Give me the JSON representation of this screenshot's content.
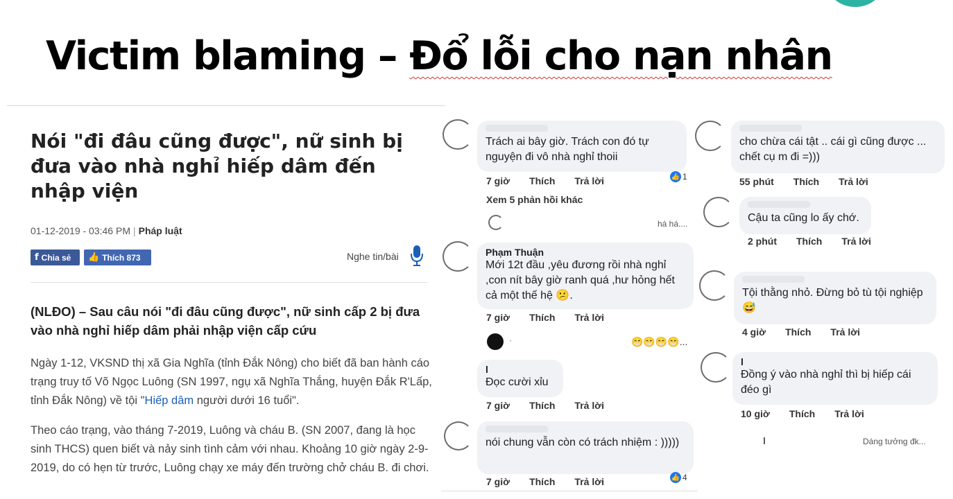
{
  "slide": {
    "title_part1": "Victim blaming – ",
    "title_part2": "Đổ lỗi cho nạn nhân"
  },
  "article": {
    "headline": "Nói \"đi đâu cũng được\", nữ sinh bị đưa vào nhà nghỉ hiếp dâm đến nhập viện",
    "date": "01-12-2019 - 03:46 PM",
    "separator": "|",
    "category": "Pháp luật",
    "share_label": "Chia sẻ",
    "like_label": "Thích 873",
    "listen_label": "Nghe tin/bài",
    "lead": "(NLĐO) – Sau câu nói \"đi đâu cũng được\", nữ sinh cấp 2 bị đưa vào nhà nghỉ hiếp dâm phải nhập viện cấp cứu",
    "para1_before": "Ngày 1-12, VKSND thị xã Gia Nghĩa (tỉnh Đắk Nông) cho biết đã ban hành cáo trạng truy tố Võ Ngọc Luông (SN 1997, ngụ xã Nghĩa Thắng, huyện Đắk R'Lấp, tỉnh Đắk Nông) về tội \"",
    "para1_link": "Hiếp dâm",
    "para1_after": " người dưới 16 tuổi\".",
    "para2": "Theo cáo trạng, vào tháng 7-2019, Luông và cháu B. (SN 2007, đang là học sinh THCS) quen biết và nảy sinh tình cảm với nhau. Khoảng 10 giờ ngày 2-9-2019, do có hẹn từ trước, Luông chạy xe máy đến trường chở cháu B. đi chơi."
  },
  "comments_left": [
    {
      "name": "",
      "text": "Trách ai bây giờ. Trách con đó tự nguyện đi vô nhà nghỉ thoii",
      "time": "7 giờ",
      "like": "Thích",
      "reply": "Trả lời",
      "reactions": "1"
    },
    {
      "more_replies": "Xem 5 phản hồi khác",
      "snippet": "há há...."
    },
    {
      "name": "Phạm Thuận",
      "text": "Mới 12t đầu ,yêu đương rồi nhà nghỉ ,con nít bây giờ ranh quá ,hư hỏng hết cả một thế hệ 😕.",
      "time": "7 giờ",
      "like": "Thích",
      "reply": "Trả lời"
    },
    {
      "dot_label": "·",
      "emoji": "😁😁😁😁..."
    },
    {
      "name": "l",
      "text": "Đọc cười xỉu",
      "time": "7 giờ",
      "like": "Thích",
      "reply": "Trả lời"
    },
    {
      "name": "",
      "text": "nói chung vẫn còn có trách nhiệm : )))))",
      "time": "7 giờ",
      "like": "Thích",
      "reply": "Trả lời",
      "reactions": "4"
    }
  ],
  "comments_right": [
    {
      "name": "",
      "text": "cho chừa cái tật .. cái gì cũng được ... chết cụ m đi =)))",
      "time": "55 phút",
      "like": "Thích",
      "reply": "Trả lời"
    },
    {
      "name": "",
      "text": "Cậu ta cũng lo ấy chớ.",
      "time": "2 phút",
      "like": "Thích",
      "reply": "Trả lời"
    },
    {
      "name": "",
      "text": "Tội thằng nhỏ. Đừng bỏ tù tội nghiệp 😅",
      "time": "4 giờ",
      "like": "Thích",
      "reply": "Trả lời"
    },
    {
      "name": "l",
      "text": "Đồng ý vào nhà nghỉ thì bị hiếp cái đéo gì",
      "time": "10 giờ",
      "like": "Thích",
      "reply": "Trả lời"
    },
    {
      "marker": "l",
      "snippet": "Dáng tưởng đk..."
    }
  ],
  "colors": {
    "share": "#3b5998",
    "like": "#4267b2",
    "accent_teal": "#2bb3a3",
    "link": "#1a5fb4"
  }
}
